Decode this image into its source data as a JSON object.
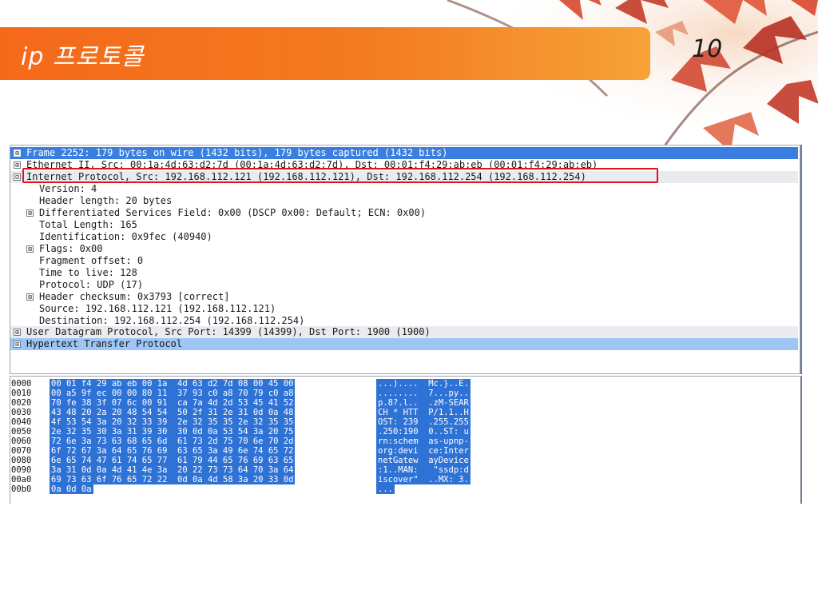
{
  "slide": {
    "title": "ip 프로토콜",
    "page_number": "10"
  },
  "detail": {
    "rows": [
      {
        "toggle": "⊞",
        "text": "Frame 2252: 179 bytes on wire (1432 bits), 179 bytes captured (1432 bits)"
      },
      {
        "toggle": "⊞",
        "text": "Ethernet II, Src: 00:1a:4d:63:d2:7d (00:1a:4d:63:d2:7d), Dst: 00:01:f4:29:ab:eb (00:01:f4:29:ab:eb)"
      },
      {
        "toggle": "⊟",
        "text": "Internet Protocol, Src: 192.168.112.121 (192.168.112.121), Dst: 192.168.112.254 (192.168.112.254)"
      },
      {
        "toggle": "",
        "text": "Version: 4"
      },
      {
        "toggle": "",
        "text": "Header length: 20 bytes"
      },
      {
        "toggle": "⊞",
        "text": "Differentiated Services Field: 0x00 (DSCP 0x00: Default; ECN: 0x00)"
      },
      {
        "toggle": "",
        "text": "Total Length: 165"
      },
      {
        "toggle": "",
        "text": "Identification: 0x9fec (40940)"
      },
      {
        "toggle": "⊞",
        "text": "Flags: 0x00"
      },
      {
        "toggle": "",
        "text": "Fragment offset: 0"
      },
      {
        "toggle": "",
        "text": "Time to live: 128"
      },
      {
        "toggle": "",
        "text": "Protocol: UDP (17)"
      },
      {
        "toggle": "⊞",
        "text": "Header checksum: 0x3793 [correct]"
      },
      {
        "toggle": "",
        "text": "Source: 192.168.112.121 (192.168.112.121)"
      },
      {
        "toggle": "",
        "text": "Destination: 192.168.112.254 (192.168.112.254)"
      },
      {
        "toggle": "⊞",
        "text": "User Datagram Protocol, Src Port: 14399 (14399), Dst Port: 1900 (1900)"
      },
      {
        "toggle": "⊞",
        "text": "Hypertext Transfer Protocol"
      }
    ]
  },
  "hex": {
    "lines": [
      {
        "offset": "0000",
        "bytes": "00 01 f4 29 ab eb 00 1a  4d 63 d2 7d 08 00 45 00",
        "ascii": "...)....  Mc.}..E."
      },
      {
        "offset": "0010",
        "bytes": "00 a5 9f ec 00 00 80 11  37 93 c0 a8 70 79 c0 a8",
        "ascii": "........  7...py.."
      },
      {
        "offset": "0020",
        "bytes": "70 fe 38 3f 07 6c 00 91  ca 7a 4d 2d 53 45 41 52",
        "ascii": "p.8?.l..  .zM-SEAR"
      },
      {
        "offset": "0030",
        "bytes": "43 48 20 2a 20 48 54 54  50 2f 31 2e 31 0d 0a 48",
        "ascii": "CH * HTT  P/1.1..H"
      },
      {
        "offset": "0040",
        "bytes": "4f 53 54 3a 20 32 33 39  2e 32 35 35 2e 32 35 35",
        "ascii": "OST: 239  .255.255"
      },
      {
        "offset": "0050",
        "bytes": "2e 32 35 30 3a 31 39 30  30 0d 0a 53 54 3a 20 75",
        "ascii": ".250:190  0..ST: u"
      },
      {
        "offset": "0060",
        "bytes": "72 6e 3a 73 63 68 65 6d  61 73 2d 75 70 6e 70 2d",
        "ascii": "rn:schem  as-upnp-"
      },
      {
        "offset": "0070",
        "bytes": "6f 72 67 3a 64 65 76 69  63 65 3a 49 6e 74 65 72",
        "ascii": "org:devi  ce:Inter"
      },
      {
        "offset": "0080",
        "bytes": "6e 65 74 47 61 74 65 77  61 79 44 65 76 69 63 65",
        "ascii": "netGatew  ayDevice"
      },
      {
        "offset": "0090",
        "bytes": "3a 31 0d 0a 4d 41 4e 3a  20 22 73 73 64 70 3a 64",
        "ascii": ":1..MAN:   \"ssdp:d"
      },
      {
        "offset": "00a0",
        "bytes": "69 73 63 6f 76 65 72 22  0d 0a 4d 58 3a 20 33 0d",
        "ascii": "iscover\"  ..MX: 3."
      },
      {
        "offset": "00b0",
        "bytes": "0a 0d 0a",
        "ascii": "..."
      }
    ]
  },
  "colors": {
    "header_orange": "#f5691b",
    "selection_blue": "#3a7ee0",
    "hex_highlight": "#2f72d6",
    "annotation_red": "#e0141e"
  }
}
